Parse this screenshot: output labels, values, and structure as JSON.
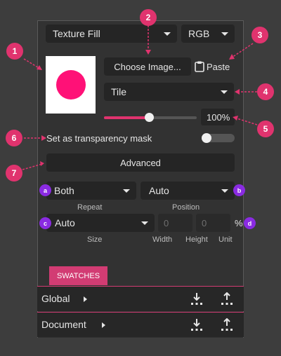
{
  "fill": {
    "type": "Texture Fill",
    "mode": "RGB"
  },
  "image": {
    "choose_label": "Choose Image...",
    "paste_label": "Paste",
    "swatch_color": "#ff1177"
  },
  "tile": {
    "value": "Tile"
  },
  "opacity": {
    "value_text": "100%",
    "fraction": 0.45
  },
  "mask": {
    "label": "Set as transparency mask",
    "enabled": false
  },
  "advanced": {
    "label": "Advanced"
  },
  "repeat": {
    "value": "Both",
    "caption": "Repeat"
  },
  "position": {
    "value": "Auto",
    "caption": "Position"
  },
  "size": {
    "value": "Auto",
    "caption": "Size",
    "width": "0",
    "height": "0",
    "unit": "%",
    "width_label": "Width",
    "height_label": "Height",
    "unit_label": "Unit"
  },
  "swatches": {
    "tab_label": "SWATCHES",
    "rows": [
      {
        "label": "Global"
      },
      {
        "label": "Document"
      }
    ]
  },
  "callouts": [
    "1",
    "2",
    "3",
    "4",
    "5",
    "6",
    "7"
  ],
  "mini_callouts": [
    "a",
    "b",
    "c",
    "d"
  ],
  "colors": {
    "accent": "#e0336e",
    "mini": "#8a2be2",
    "panel": "#323232"
  }
}
